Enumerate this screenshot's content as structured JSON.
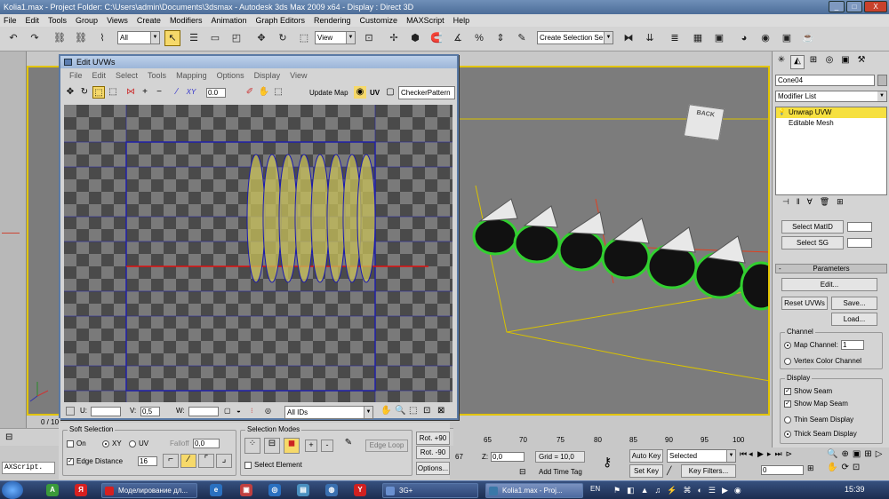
{
  "window": {
    "title": "Kolia1.max     - Project Folder: C:\\Users\\admin\\Documents\\3dsmax          - Autodesk 3ds Max  2009 x64          - Display : Direct 3D",
    "buttons": [
      "_",
      "□",
      "X"
    ]
  },
  "menubar": {
    "items": [
      "File",
      "Edit",
      "Tools",
      "Group",
      "Views",
      "Create",
      "Modifiers",
      "Animation",
      "Graph Editors",
      "Rendering",
      "Customize",
      "MAXScript",
      "Help"
    ]
  },
  "main_toolbar": {
    "selection_filter": "All",
    "reference_coord": "View",
    "named_selection_placeholder": "Create Selection Se"
  },
  "viewport": {
    "nav_cube_label": "BACK"
  },
  "command_panel": {
    "object_name": "Cone04",
    "modifier_list_label": "Modifier List",
    "stack": [
      {
        "label": "Unwrap UVW",
        "selected": true
      },
      {
        "label": "Editable Mesh",
        "selected": false
      }
    ],
    "select_matid_label": "Select MatID",
    "select_sg_label": "Select SG",
    "parameters_header": "Parameters",
    "edit_label": "Edit...",
    "reset_uvws_label": "Reset UVWs",
    "save_label": "Save...",
    "load_label": "Load...",
    "channel_group": "Channel",
    "map_channel_label": "Map Channel:",
    "map_channel_value": "1",
    "vertex_color_label": "Vertex Color Channel",
    "display_group": "Display",
    "show_seam_label": "Show Seam",
    "show_map_seam_label": "Show Map Seam",
    "thin_seam_label": "Thin Seam Display",
    "thick_seam_label": "Thick Seam Display"
  },
  "uvw_editor": {
    "title": "Edit UVWs",
    "menu": [
      "File",
      "Edit",
      "Select",
      "Tools",
      "Mapping",
      "Options",
      "Display",
      "View"
    ],
    "rotation_value": "0.0",
    "update_map_label": "Update Map",
    "uv_label": "UV",
    "texture_dropdown": "CheckerPattern",
    "status": {
      "u_label": "U:",
      "u_value": "",
      "v_label": "V:",
      "v_value": "0,5",
      "w_label": "W:",
      "w_value": "",
      "ids_dropdown": "All IDs"
    }
  },
  "soft_selection": {
    "group_label": "Soft Selection",
    "on_label": "On",
    "xy_label": "XY",
    "uv_label": "UV",
    "falloff_label": "Falloff",
    "falloff_value": "0,0",
    "edge_distance_label": "Edge Distance",
    "edge_distance_value": "16"
  },
  "selection_modes": {
    "group_label": "Selection Modes",
    "edge_loop_label": "Edge Loop",
    "select_element_label": "Select Element"
  },
  "rotation_buttons": {
    "rot_plus": "Rot. +90",
    "rot_minus": "Rot. -90",
    "options": "Options..."
  },
  "timeline": {
    "frame_counter": "0 / 10",
    "ticks": [
      "65",
      "70",
      "75",
      "80",
      "85",
      "90",
      "95",
      "100"
    ],
    "z_label": "Z:",
    "z_value": "0,0",
    "partial_value": "67",
    "grid_label": "Grid = 10,0",
    "add_time_tag": "Add Time Tag",
    "auto_key": "Auto Key",
    "set_key": "Set Key",
    "key_mode_dropdown": "Selected",
    "key_filters": "Key Filters...",
    "frame_value": "0"
  },
  "maxscript": {
    "label": "AXScript."
  },
  "taskbar": {
    "tasks": [
      {
        "label": "Моделирование дл...",
        "color": "#d62020"
      },
      {
        "label": "3G+",
        "color": "#6a90d0"
      },
      {
        "label": "Kolia1.max - Proj...",
        "color": "#3a78a8"
      }
    ],
    "language": "EN",
    "clock": "15:39"
  }
}
